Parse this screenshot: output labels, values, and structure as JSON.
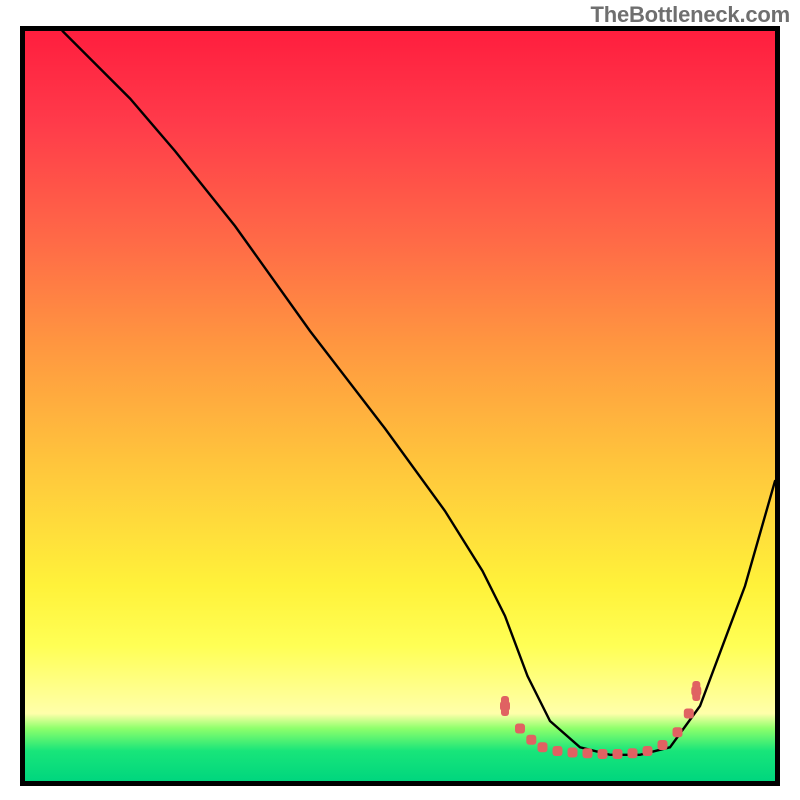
{
  "watermark": "TheBottleneck.com",
  "chart_data": {
    "type": "line",
    "title": "",
    "xlabel": "",
    "ylabel": "",
    "xlim": [
      0,
      100
    ],
    "ylim": [
      0,
      100
    ],
    "series": [
      {
        "name": "curve",
        "x": [
          5,
          9,
          14,
          20,
          28,
          38,
          48,
          56,
          61,
          64,
          67,
          70,
          74,
          78,
          82,
          86,
          90,
          96,
          100
        ],
        "y": [
          100,
          96,
          91,
          84,
          74,
          60,
          47,
          36,
          28,
          22,
          14,
          8,
          4.5,
          3.5,
          3.5,
          4.5,
          10,
          26,
          40
        ]
      }
    ],
    "flat_region_marker": {
      "color": "#e06262",
      "points_x": [
        64,
        66,
        67.5,
        69,
        71,
        73,
        75,
        77,
        79,
        81,
        83,
        85,
        87,
        88.5,
        89.5
      ],
      "points_y": [
        10,
        7,
        5.5,
        4.5,
        4,
        3.8,
        3.7,
        3.6,
        3.6,
        3.7,
        4,
        4.8,
        6.5,
        9,
        12
      ]
    },
    "gradient_stops": [
      {
        "pct": 0,
        "color": "#ff1e3e"
      },
      {
        "pct": 12,
        "color": "#ff3a4a"
      },
      {
        "pct": 28,
        "color": "#ff6a47"
      },
      {
        "pct": 42,
        "color": "#ff9740"
      },
      {
        "pct": 58,
        "color": "#ffc63c"
      },
      {
        "pct": 74,
        "color": "#fff23a"
      },
      {
        "pct": 82,
        "color": "#ffff55"
      },
      {
        "pct": 88,
        "color": "#ffff8e"
      },
      {
        "pct": 91,
        "color": "#ffffaa"
      },
      {
        "pct": 93,
        "color": "#8dff6b"
      },
      {
        "pct": 96,
        "color": "#18e57a"
      },
      {
        "pct": 100,
        "color": "#00d67e"
      }
    ]
  }
}
